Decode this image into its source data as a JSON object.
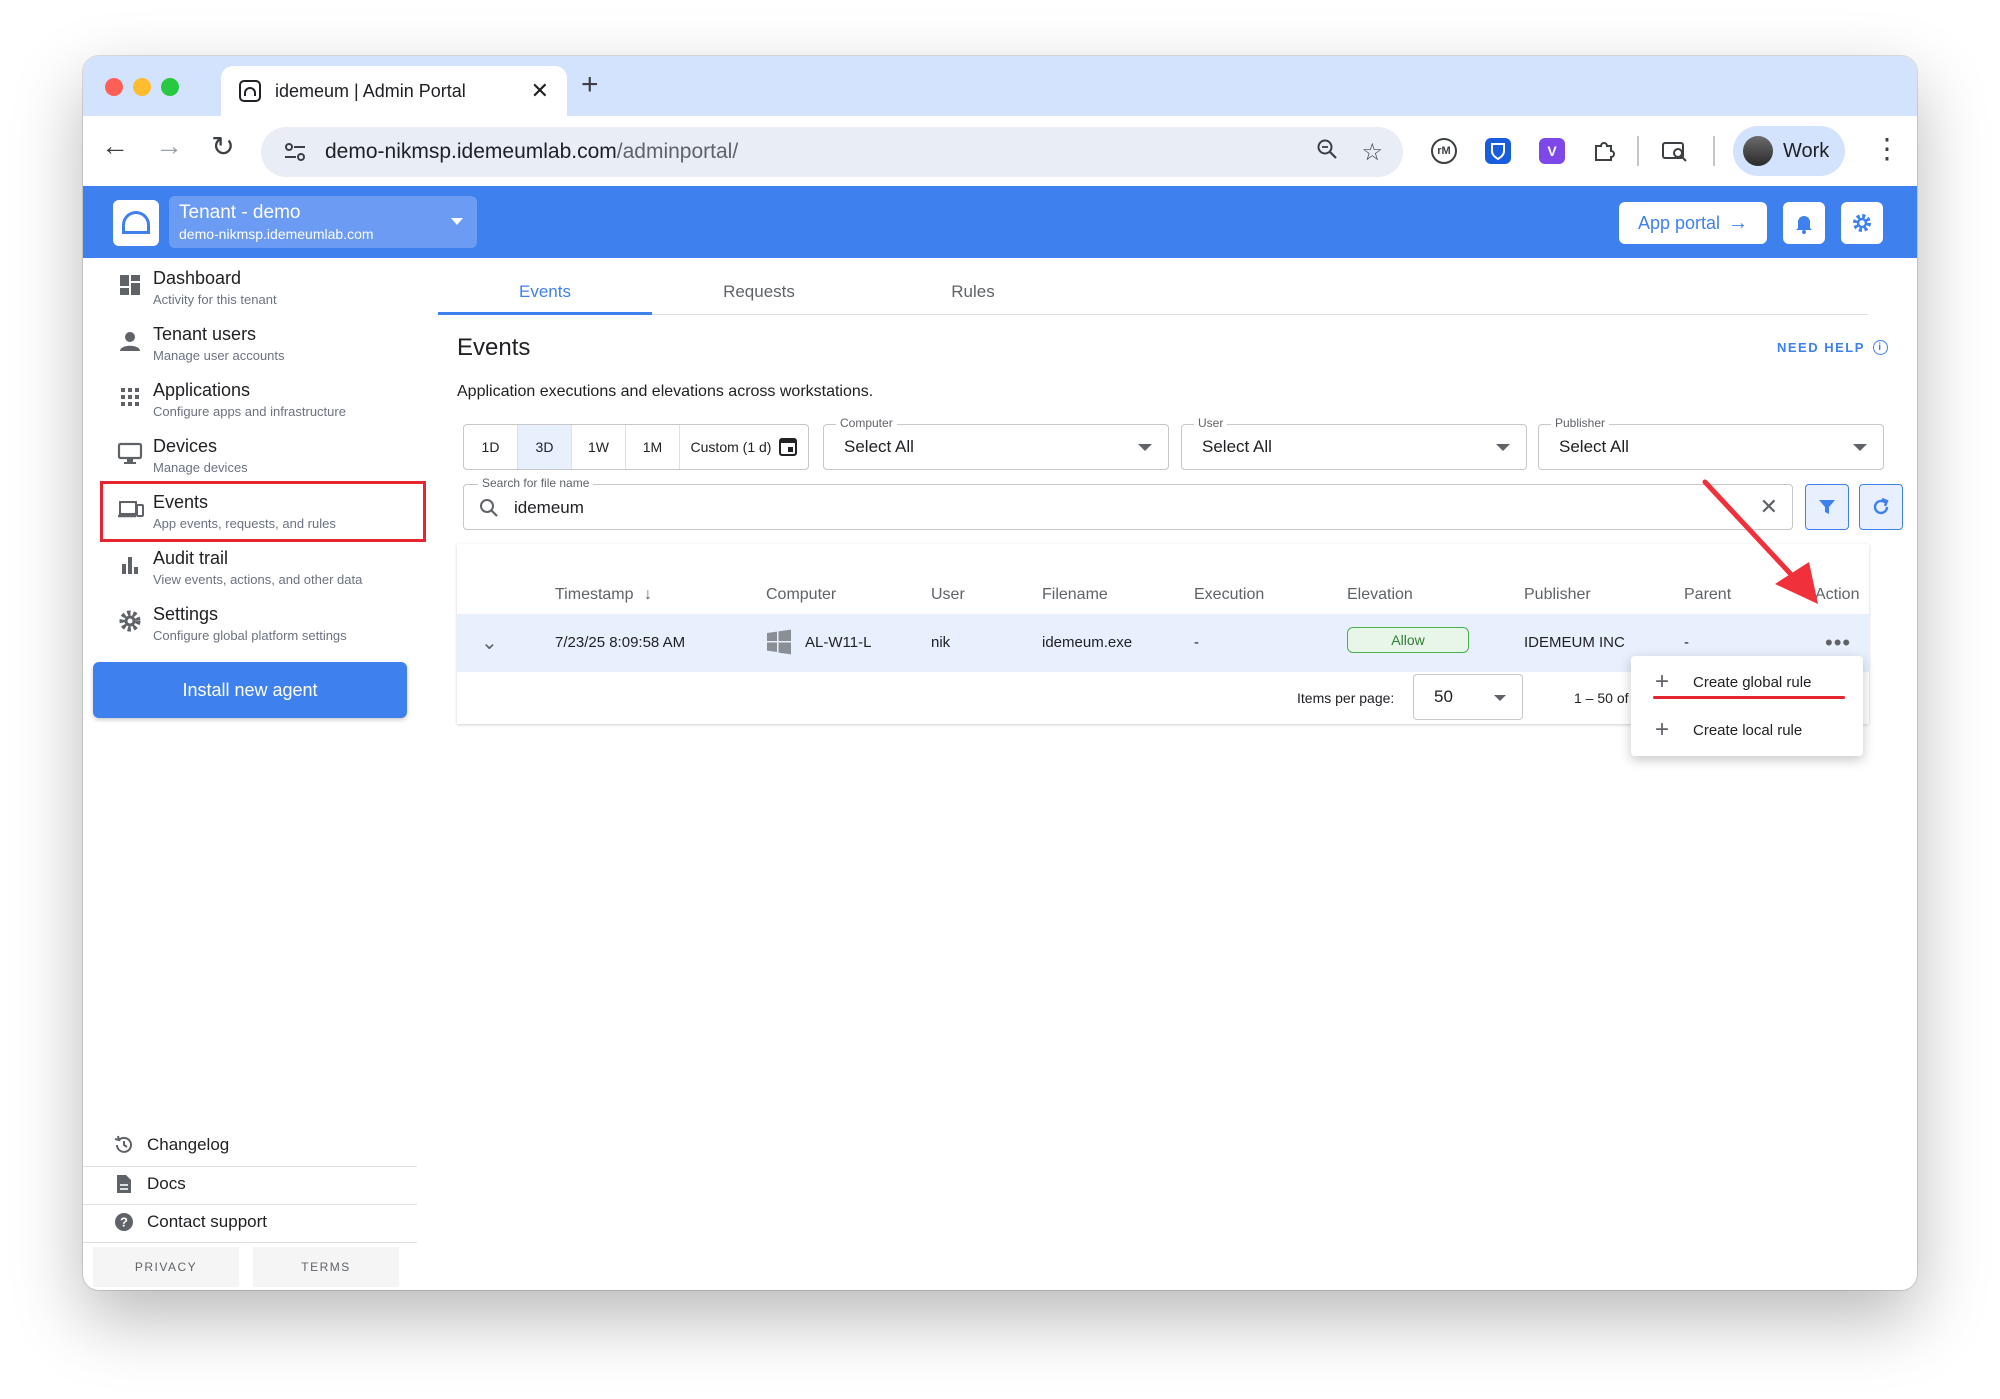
{
  "browser": {
    "tab_title": "idemeum | Admin Portal",
    "url_host": "demo-nikmsp.idemeumlab.com",
    "url_path": "/adminportal/",
    "profile_label": "Work",
    "extensions": [
      "rM",
      "bitwarden-icon",
      "V"
    ]
  },
  "header": {
    "tenant_name": "Tenant - demo",
    "tenant_domain": "demo-nikmsp.idemeumlab.com",
    "app_portal_label": "App portal",
    "accent": "#3f80ef"
  },
  "sidebar": {
    "items": [
      {
        "title": "Dashboard",
        "subtitle": "Activity for this tenant",
        "icon": "dashboard-icon"
      },
      {
        "title": "Tenant users",
        "subtitle": "Manage user accounts",
        "icon": "person-icon"
      },
      {
        "title": "Applications",
        "subtitle": "Configure apps and infrastructure",
        "icon": "apps-grid-icon"
      },
      {
        "title": "Devices",
        "subtitle": "Manage devices",
        "icon": "monitor-icon"
      },
      {
        "title": "Events",
        "subtitle": "App events, requests, and rules",
        "icon": "devices-icon",
        "active": true
      },
      {
        "title": "Audit trail",
        "subtitle": "View events, actions, and other data",
        "icon": "bar-chart-icon"
      },
      {
        "title": "Settings",
        "subtitle": "Configure global platform settings",
        "icon": "gear-icon"
      }
    ],
    "install_button": "Install new agent",
    "footer": [
      {
        "label": "Changelog",
        "icon": "history-icon"
      },
      {
        "label": "Docs",
        "icon": "document-icon"
      },
      {
        "label": "Contact support",
        "icon": "help-icon"
      }
    ],
    "privacy_label": "PRIVACY",
    "terms_label": "TERMS"
  },
  "main": {
    "tabs": [
      "Events",
      "Requests",
      "Rules"
    ],
    "active_tab": "Events",
    "title": "Events",
    "need_help": "NEED HELP",
    "description": "Application executions and elevations across workstations.",
    "range_buttons": [
      "1D",
      "3D",
      "1W",
      "1M"
    ],
    "selected_range": "3D",
    "custom_range": "Custom (1 d)",
    "filters": [
      {
        "label": "Computer",
        "value": "Select All"
      },
      {
        "label": "User",
        "value": "Select All"
      },
      {
        "label": "Publisher",
        "value": "Select All"
      }
    ],
    "search": {
      "label": "Search for file name",
      "value": "idemeum"
    },
    "table": {
      "columns": [
        "Timestamp",
        "Computer",
        "User",
        "Filename",
        "Execution",
        "Elevation",
        "Publisher",
        "Parent",
        "Action"
      ],
      "rows": [
        {
          "timestamp": "7/23/25 8:09:58 AM",
          "computer": "AL-W11-L",
          "user": "nik",
          "filename": "idemeum.exe",
          "execution": "-",
          "elevation": "Allow",
          "publisher": "IDEMEUM INC",
          "parent": "-"
        }
      ]
    },
    "pagination": {
      "items_per_page_label": "Items per page:",
      "items_per_page": "50",
      "range_text": "1 – 50 of"
    },
    "action_menu": [
      "Create global rule",
      "Create local rule"
    ]
  }
}
